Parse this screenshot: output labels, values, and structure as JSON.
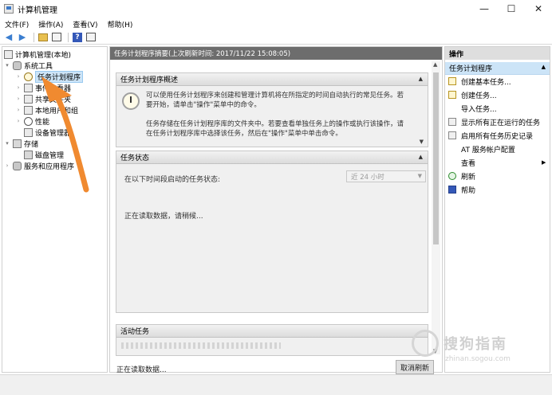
{
  "window": {
    "title": "计算机管理",
    "controls": {
      "minimize": "—",
      "maximize": "☐",
      "close": "✕"
    }
  },
  "menu": {
    "items": [
      "文件(F)",
      "操作(A)",
      "查看(V)",
      "帮助(H)"
    ]
  },
  "tree": {
    "items": [
      {
        "label": "计算机管理(本地)"
      },
      {
        "label": "系统工具"
      },
      {
        "label": "任务计划程序"
      },
      {
        "label": "事件查看器"
      },
      {
        "label": "共享文件夹"
      },
      {
        "label": "本地用户和组"
      },
      {
        "label": "性能"
      },
      {
        "label": "设备管理器"
      },
      {
        "label": "存储"
      },
      {
        "label": "磁盘管理"
      },
      {
        "label": "服务和应用程序"
      }
    ]
  },
  "center": {
    "header": "任务计划程序摘要(上次刷新时间: 2017/11/22 15:08:05)",
    "overview": {
      "title": "任务计划程序概述",
      "text1": "可以使用任务计划程序来创建和管理计算机将在所指定的时间自动执行的常见任务。若要开始，请单击\"操作\"菜单中的命令。",
      "text2": "任务存储在任务计划程序库的文件夹中。若要查看单独任务上的操作或执行该操作，请在任务计划程序库中选择该任务，然后在\"操作\"菜单中单击命令。"
    },
    "status": {
      "title": "任务状态",
      "row_label": "在以下时间段启动的任务状态:",
      "period_value": "近 24 小时",
      "loading": "正在读取数据，请稍候..."
    },
    "active": {
      "title": "活动任务"
    },
    "bottom_status": "正在读取数据...",
    "cancel_label": "取消刷新"
  },
  "actions": {
    "header": "操作",
    "section": "任务计划程序",
    "items": [
      {
        "label": "创建基本任务..."
      },
      {
        "label": "创建任务..."
      },
      {
        "label": "导入任务..."
      },
      {
        "label": "显示所有正在运行的任务"
      },
      {
        "label": "启用所有任务历史记录"
      },
      {
        "label": "AT 服务帐户配置"
      },
      {
        "label": "查看"
      },
      {
        "label": "刷新"
      },
      {
        "label": "帮助"
      }
    ]
  },
  "watermark": {
    "text": "搜狗指南",
    "url": "zhinan.sogou.com"
  },
  "colors": {
    "selection": "#cce4f7",
    "annotation_arrow": "#f08a30",
    "center_header": "#6d6d6d"
  }
}
